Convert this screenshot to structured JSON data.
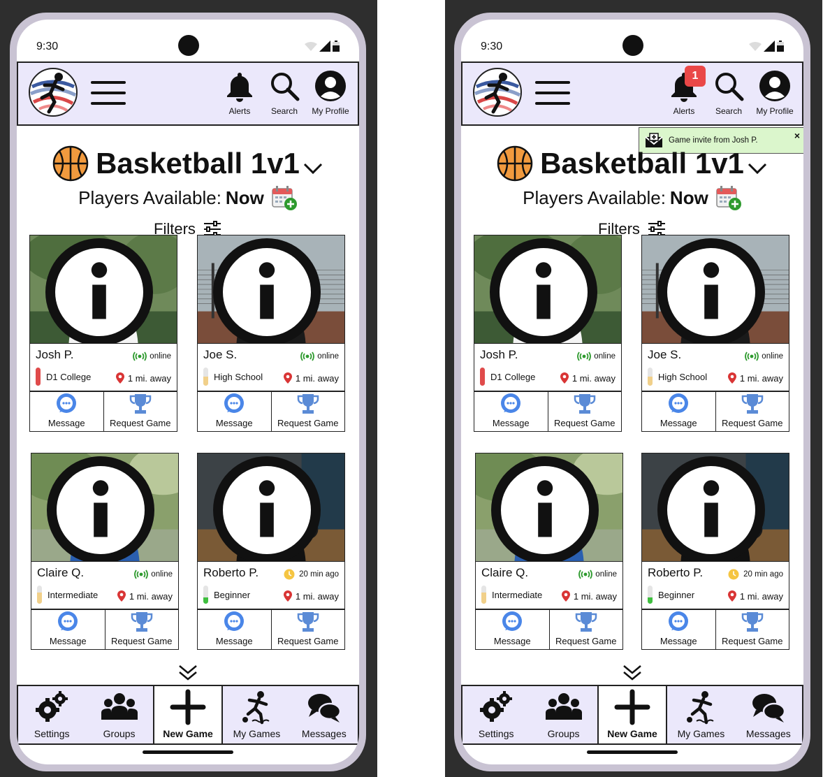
{
  "screens": [
    {
      "status_bar": {
        "time": "9:30"
      },
      "header": {
        "alerts_label": "Alerts",
        "search_label": "Search",
        "profile_label": "My Profile",
        "alert_badge": ""
      },
      "notification": null,
      "sport": {
        "title": "Basketball 1v1"
      },
      "availability": {
        "label": "Players Available:",
        "value": "Now"
      },
      "filters_label": "Filters",
      "players": [
        {
          "name": "Josh P.",
          "status": "online",
          "status_type": "online",
          "level": "D1 College",
          "level_fill": 1.0,
          "level_color": "#e04b4b",
          "distance": "1 mi. away",
          "message_label": "Message",
          "request_label": "Request Game"
        },
        {
          "name": "Joe S.",
          "status": "online",
          "status_type": "online",
          "level": "High School",
          "level_fill": 0.5,
          "level_color": "#f1d08a",
          "distance": "1 mi. away",
          "message_label": "Message",
          "request_label": "Request Game"
        },
        {
          "name": "Claire Q.",
          "status": "online",
          "status_type": "online",
          "level": "Intermediate",
          "level_fill": 0.6,
          "level_color": "#f1d08a",
          "distance": "1 mi. away",
          "message_label": "Message",
          "request_label": "Request Game"
        },
        {
          "name": "Roberto P.",
          "status": "20 min ago",
          "status_type": "away",
          "level": "Beginner",
          "level_fill": 0.35,
          "level_color": "#3fbf3f",
          "distance": "1 mi. away",
          "message_label": "Message",
          "request_label": "Request Game"
        }
      ],
      "nav": {
        "settings": "Settings",
        "groups": "Groups",
        "new_game": "New Game",
        "my_games": "My Games",
        "messages": "Messages"
      }
    },
    {
      "status_bar": {
        "time": "9:30"
      },
      "header": {
        "alerts_label": "Alerts",
        "search_label": "Search",
        "profile_label": "My Profile",
        "alert_badge": "1"
      },
      "notification": {
        "text": "Game invite from Josh P.",
        "close": "×"
      },
      "sport": {
        "title": "Basketball 1v1"
      },
      "availability": {
        "label": "Players Available:",
        "value": "Now"
      },
      "filters_label": "Filters",
      "players": [
        {
          "name": "Josh P.",
          "status": "online",
          "status_type": "online",
          "level": "D1 College",
          "level_fill": 1.0,
          "level_color": "#e04b4b",
          "distance": "1 mi. away",
          "message_label": "Message",
          "request_label": "Request Game"
        },
        {
          "name": "Joe S.",
          "status": "online",
          "status_type": "online",
          "level": "High School",
          "level_fill": 0.5,
          "level_color": "#f1d08a",
          "distance": "1 mi. away",
          "message_label": "Message",
          "request_label": "Request Game"
        },
        {
          "name": "Claire Q.",
          "status": "online",
          "status_type": "online",
          "level": "Intermediate",
          "level_fill": 0.6,
          "level_color": "#f1d08a",
          "distance": "1 mi. away",
          "message_label": "Message",
          "request_label": "Request Game"
        },
        {
          "name": "Roberto P.",
          "status": "20 min ago",
          "status_type": "away",
          "level": "Beginner",
          "level_fill": 0.35,
          "level_color": "#3fbf3f",
          "distance": "1 mi. away",
          "message_label": "Message",
          "request_label": "Request Game"
        }
      ],
      "nav": {
        "settings": "Settings",
        "groups": "Groups",
        "new_game": "New Game",
        "my_games": "My Games",
        "messages": "Messages"
      }
    }
  ],
  "colors": {
    "header_bg": "#ebe8fb",
    "message_blue": "#4a86e8",
    "trophy_blue": "#5b8bd6",
    "online_green": "#2e9a2e",
    "pin_red": "#d93535",
    "badge_red": "#ea4747",
    "notification_bg": "#dbf6cc"
  }
}
